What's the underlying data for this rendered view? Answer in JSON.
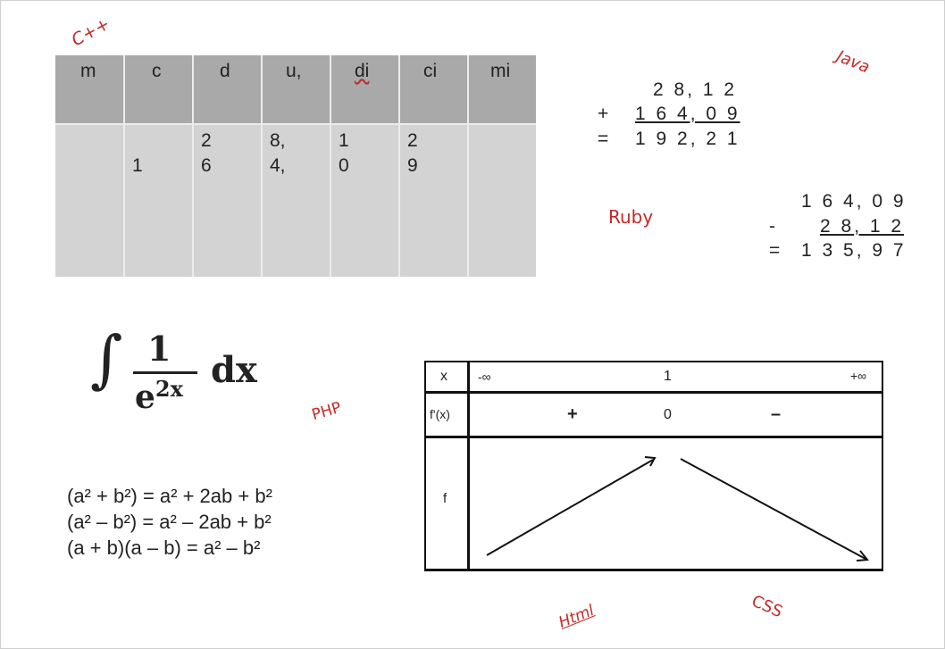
{
  "annotations": {
    "cpp": "C++",
    "java": "Java",
    "ruby": "Ruby",
    "php": "PHP",
    "html": "Html",
    "css": "CSS"
  },
  "place_value_table": {
    "headers": [
      "m",
      "c",
      "d",
      "u,",
      "di",
      "ci",
      "mi"
    ],
    "digits": {
      "c": "1",
      "d": [
        "2",
        "6"
      ],
      "u": [
        "8,",
        "4,"
      ],
      "di": [
        "1",
        "0"
      ],
      "ci": [
        "2",
        "9"
      ]
    }
  },
  "addition": {
    "operand1": "2 8, 1 2",
    "operator": "+",
    "operand2": "1 6 4, 0 9",
    "equals": "=",
    "result": "1 9 2, 2 1"
  },
  "subtraction": {
    "operand1": "1 6 4, 0 9",
    "operator": "-",
    "operand2": "2 8, 1 2",
    "equals": "=",
    "result": "1 3 5, 9 7"
  },
  "integral": {
    "sign": "∫",
    "numerator": "1",
    "denominator_base": "e",
    "denominator_exponent": "2x",
    "differential": "dx"
  },
  "identities": [
    "(a² + b²) = a² + 2ab + b²",
    "(a² – b²) = a² – 2ab + b²",
    "(a + b)(a – b) = a² – b²"
  ],
  "variation_table": {
    "x_label": "x",
    "x_values": [
      "-∞",
      "1",
      "+∞"
    ],
    "derivative_label": "f'(x)",
    "derivative_signs": [
      "+",
      "0",
      "–"
    ],
    "function_label": "f"
  }
}
